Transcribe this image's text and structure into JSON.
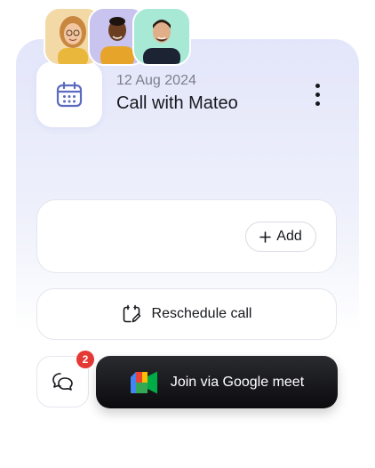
{
  "event": {
    "date": "12 Aug 2024",
    "title": "Call with Mateo"
  },
  "participants": {
    "avatars": [
      "avatar-woman-glasses",
      "avatar-man-yellow-shirt",
      "avatar-man-dark-shirt"
    ],
    "add_label": "Add"
  },
  "actions": {
    "reschedule_label": "Reschedule call",
    "join_label": "Join via Google meet",
    "chat_badge_count": "2"
  },
  "icons": {
    "calendar": "calendar-icon",
    "more": "more-vertical-icon",
    "plus": "plus-icon",
    "reschedule": "calendar-edit-icon",
    "chat": "chat-bubbles-icon",
    "meet": "google-meet-icon"
  },
  "colors": {
    "accent": "#5b6bbf",
    "badge": "#e53935",
    "join_button": "#111114"
  }
}
